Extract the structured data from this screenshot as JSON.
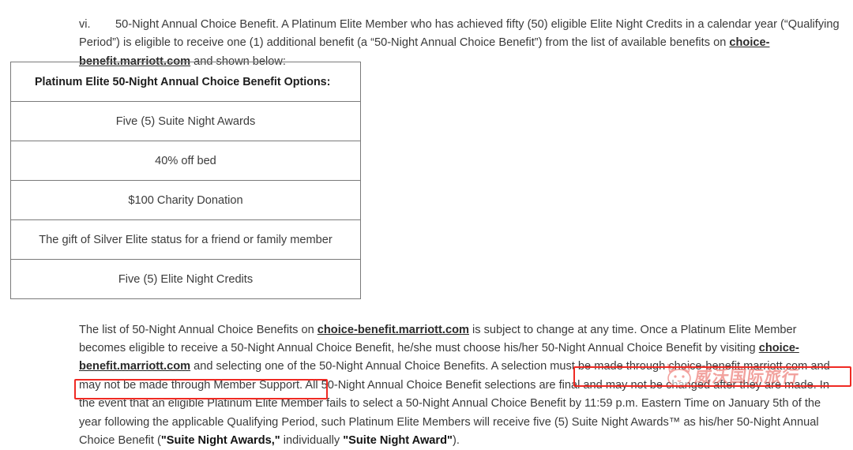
{
  "document": {
    "top_paragraph": {
      "marker": "vi.",
      "text_run_1": "50-Night Annual Choice Benefit. A Platinum Elite Member who has achieved fifty (50) eligible Elite Night Credits in a calendar year (“Qualifying Period”) is eligible to receive one (1) additional benefit (a “50-Night Annual Choice Benefit”) from the list of available benefits on ",
      "link_1": "choice-benefit.marriott.com",
      "text_run_2": " and shown below:"
    },
    "options_table": {
      "header": "Platinum Elite 50-Night Annual Choice Benefit Options:",
      "rows": [
        "Five (5) Suite Night Awards",
        "40% off bed",
        "$100 Charity Donation",
        "The gift of Silver Elite status for a friend or family member",
        "Five (5) Elite Night Credits"
      ]
    },
    "bottom_paragraph": {
      "t1": "The list of 50-Night Annual Choice Benefits on ",
      "link_1": "choice-benefit.marriott.com",
      "t2": " is subject to change at any time.  Once a Platinum Elite Member becomes eligible to receive a 50-Night Annual Choice Benefit, he/she must choose his/her 50-Night Annual Choice Benefit by visiting ",
      "link_2": "choice-benefit.marriott.com",
      "t3": " and selecting one of the 50-Night Annual Choice Benefits.  A selection must be made through choice-benefit.marriott.com and may not be made through Member Support.  All 50-Night Annual Choice Benefit selections are final and may not be changed after they are made.  In the event that an eligible Platinum Elite Member fails to select a 50-Night Annual Choice Benefit ",
      "highlight_1": "by 11:59 p.m. Eastern Time on January 5th of the year following the applicable Qualifying Period,",
      "t4": " such Platinum Elite Members will receive five (5) Suite Night Awards™ as his/her 50-Night Annual Choice Benefit (",
      "bold_1": "\"Suite Night Awards,\"",
      "t5": " individually ",
      "bold_2": "\"Suite Night Award\"",
      "t6": ")."
    },
    "annotations": {
      "box_color": "#ef2a23",
      "box_1_label": "by 11:59 p.m. Eastern Time on January 5th of the",
      "box_2_label": "year following the applicable Qualifying Period,"
    },
    "watermark": {
      "text": "威沃国际旅行",
      "color": "#e8574f"
    }
  }
}
